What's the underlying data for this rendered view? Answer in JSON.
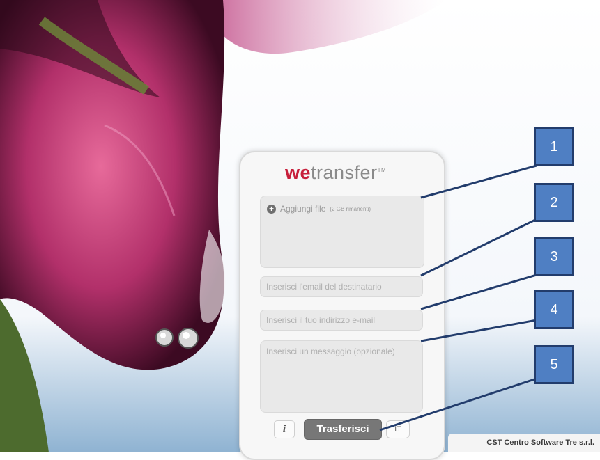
{
  "logo": {
    "we": "we",
    "transfer": "transfer",
    "tm": "TM"
  },
  "files": {
    "label": "Aggiungi file",
    "remaining": "(2 GB rimanenti)"
  },
  "recipient": {
    "placeholder": "Inserisci l'email del destinatario",
    "value": ""
  },
  "sender": {
    "placeholder": "Inserisci il tuo indirizzo e-mail",
    "value": ""
  },
  "message": {
    "placeholder": "Inserisci un messaggio (opzionale)",
    "value": ""
  },
  "buttons": {
    "info": "i",
    "transfer": "Trasferisci",
    "lang": "IT"
  },
  "callouts": [
    "1",
    "2",
    "3",
    "4",
    "5"
  ],
  "footer": {
    "company": "CST Centro Software Tre s.r.l."
  },
  "colors": {
    "brand": "#c71f3b",
    "callout_fill": "#4f7fc3",
    "callout_border": "#223c6c"
  }
}
